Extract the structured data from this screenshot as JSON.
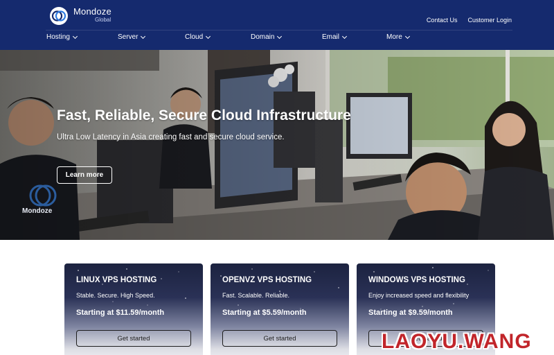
{
  "brand": {
    "name": "Mondoze",
    "subtitle": "Global",
    "logo_icon": "mondoze-rings-icon",
    "brand_color": "#152a6e"
  },
  "top_links": {
    "contact": "Contact Us",
    "login": "Customer Login"
  },
  "nav": {
    "items": [
      {
        "label": "Hosting"
      },
      {
        "label": "Server"
      },
      {
        "label": "Cloud"
      },
      {
        "label": "Domain"
      },
      {
        "label": "Email"
      },
      {
        "label": "More"
      }
    ]
  },
  "hero": {
    "title": "Fast, Reliable, Secure Cloud Infrastructure",
    "subtitle": "Ultra Low Latency in Asia  creating fast and secure cloud service.",
    "button": "Learn more",
    "shirt_print": "Mondoze"
  },
  "cards": [
    {
      "title": "LINUX VPS HOSTING",
      "description": "Stable. Secure. High Speed.",
      "price": "Starting at $11.59/month",
      "button": "Get started"
    },
    {
      "title": "OPENVZ VPS HOSTING",
      "description": "Fast. Scalable. Reliable.",
      "price": "Starting at $5.59/month",
      "button": "Get started"
    },
    {
      "title": "WINDOWS VPS HOSTING",
      "description": "Enjoy increased speed and flexibility",
      "price": "Starting at $9.59/month",
      "button": "Get started"
    }
  ],
  "watermark": "LAOYU.WANG",
  "colors": {
    "header": "#152a6e",
    "watermark": "#c1252a",
    "card_top": "#1c2340"
  }
}
